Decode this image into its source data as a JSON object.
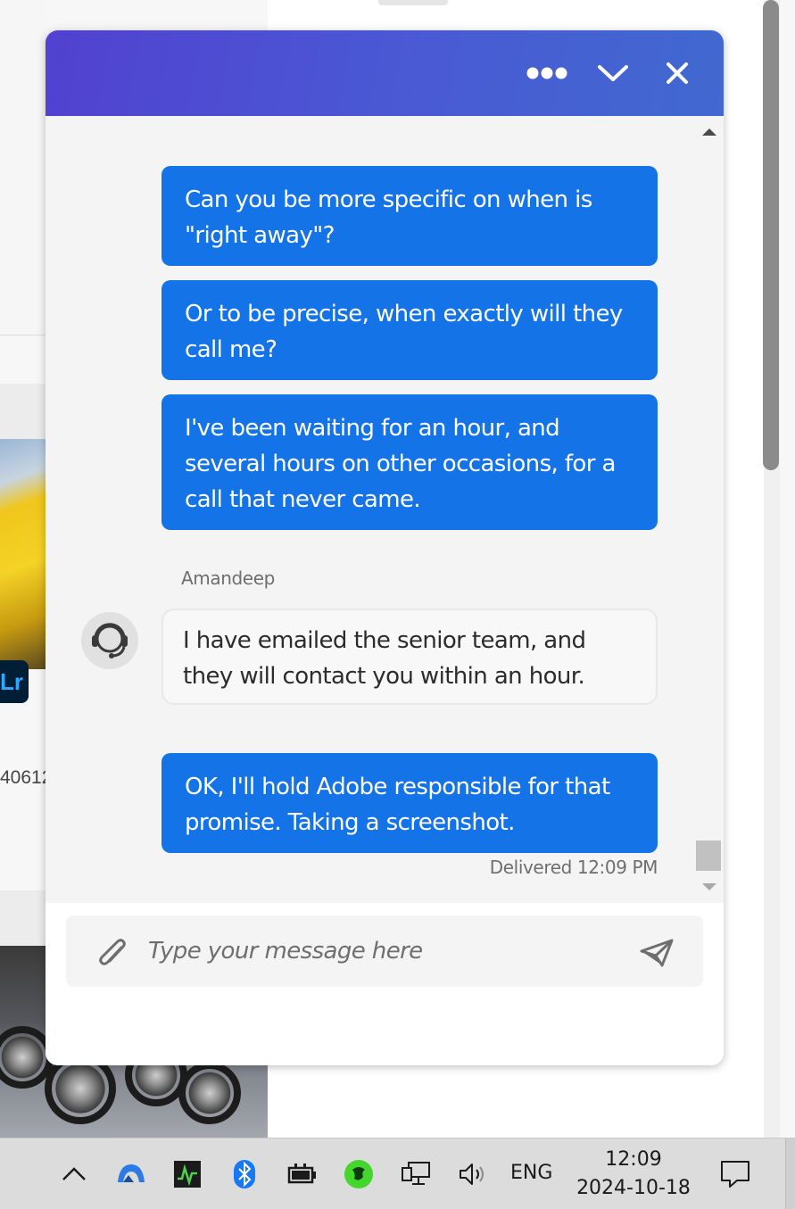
{
  "background": {
    "card_text": "40612",
    "app_badge": "Lr"
  },
  "chat": {
    "header": {
      "more_icon": "more-horizontal-icon",
      "minimize_icon": "chevron-down-icon",
      "close_icon": "close-icon"
    },
    "messages": [
      {
        "from": "user",
        "text": "Can you be more specific on when is \"right away\"?"
      },
      {
        "from": "user",
        "text": "Or to be precise, when exactly will they call me?"
      },
      {
        "from": "user",
        "text": "I've been waiting for an hour, and several hours on other occasions, for a call that never came."
      },
      {
        "from": "agent",
        "text": "I have emailed the senior team, and they will contact you within an hour."
      },
      {
        "from": "user",
        "text": "OK, I'll hold Adobe responsible for that promise. Taking a screenshot."
      }
    ],
    "agent_name": "Amandeep",
    "delivered_status": "Delivered 12:09 PM",
    "input": {
      "placeholder": "Type your message here",
      "value": ""
    },
    "colors": {
      "header_start": "#5141d0",
      "header_end": "#4169d0",
      "user_bubble": "#1473e6",
      "agent_bubble": "#f8f8f8"
    }
  },
  "taskbar": {
    "tray_icons": [
      "chevron-up-icon",
      "cloud-app-icon",
      "task-monitor-icon",
      "bluetooth-icon",
      "battery-icon",
      "razer-icon",
      "network-icon",
      "volume-icon"
    ],
    "language": "ENG",
    "time": "12:09",
    "date": "2024-10-18"
  }
}
